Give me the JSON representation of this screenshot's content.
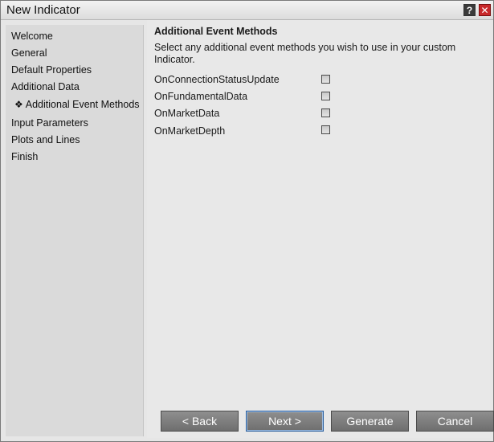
{
  "window": {
    "title": "New Indicator",
    "help_icon_glyph": "?",
    "close_icon_glyph": "✕"
  },
  "sidebar": {
    "items": [
      {
        "label": "Welcome"
      },
      {
        "label": "General"
      },
      {
        "label": "Default Properties"
      },
      {
        "label": "Additional Data"
      },
      {
        "label": "Additional Event Methods",
        "current": true,
        "icon": "diamond-bullet-icon",
        "glyph": "❖"
      },
      {
        "label": "Input Parameters"
      },
      {
        "label": "Plots and Lines"
      },
      {
        "label": "Finish"
      }
    ]
  },
  "main": {
    "heading": "Additional Event Methods",
    "description": "Select any additional event methods you wish to use in your custom Indicator.",
    "options": [
      {
        "label": "OnConnectionStatusUpdate",
        "checked": false
      },
      {
        "label": "OnFundamentalData",
        "checked": false
      },
      {
        "label": "OnMarketData",
        "checked": false
      },
      {
        "label": "OnMarketDepth",
        "checked": false
      }
    ]
  },
  "buttons": {
    "back": "< Back",
    "next": "Next >",
    "generate": "Generate",
    "cancel": "Cancel"
  },
  "colors": {
    "close_button": "#c8282a",
    "button_face": "#7f7f7f",
    "focus_border": "#2a5f9e"
  }
}
